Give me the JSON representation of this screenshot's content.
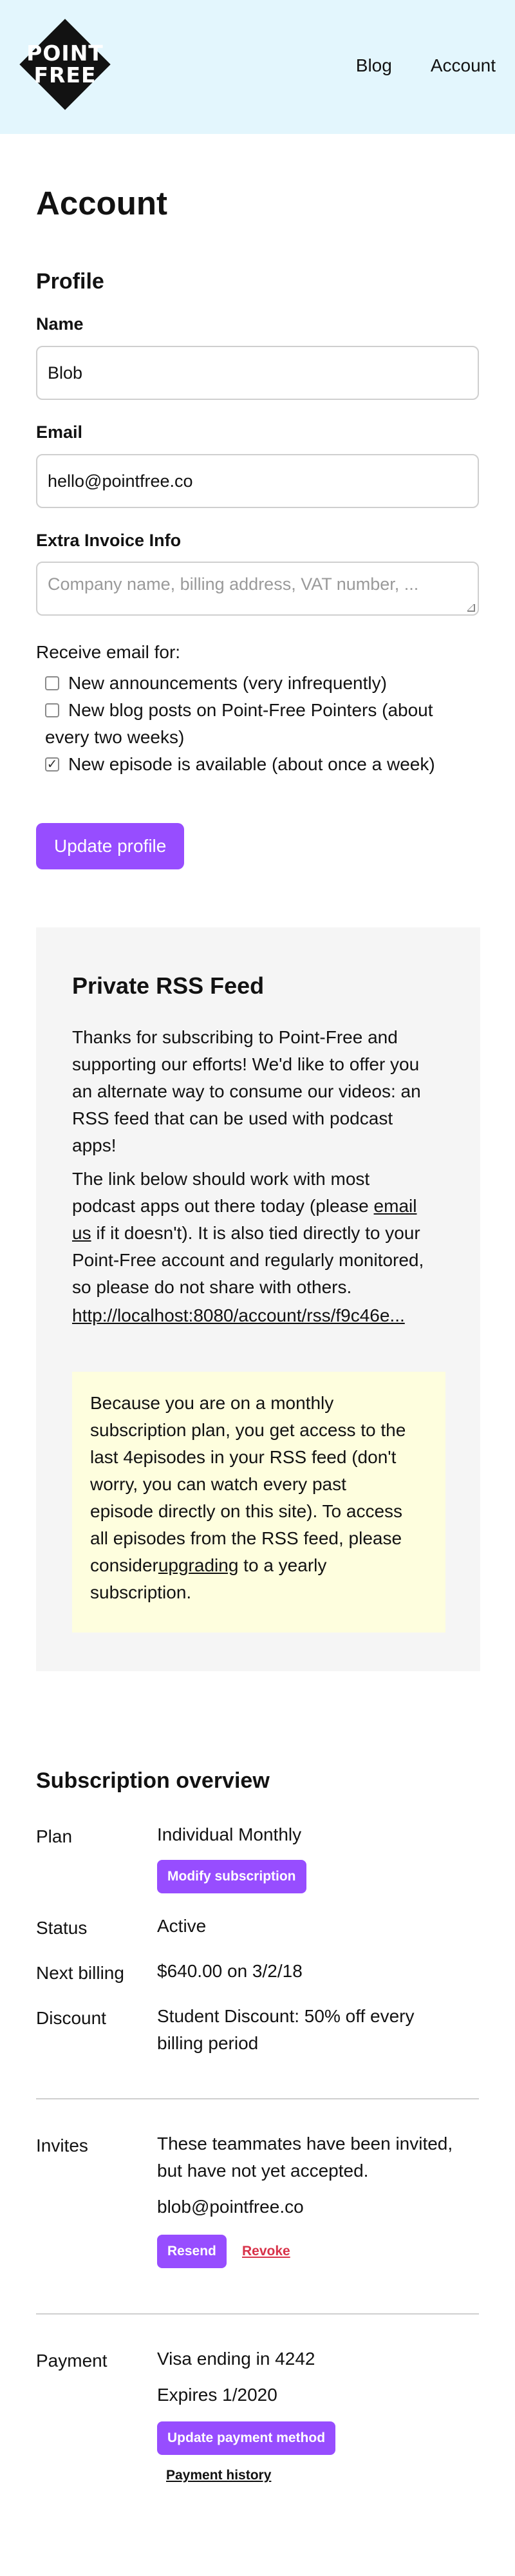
{
  "header": {
    "logo_line1": "POINT",
    "logo_line2": "FREE",
    "nav": {
      "blog": "Blog",
      "account": "Account"
    }
  },
  "page_title": "Account",
  "profile": {
    "title": "Profile",
    "name_label": "Name",
    "name_value": "Blob",
    "email_label": "Email",
    "email_value": "hello@pointfree.co",
    "invoice_label": "Extra Invoice Info",
    "invoice_placeholder": "Company name, billing address, VAT number, ...",
    "receive_label": "Receive email for:",
    "checkboxes": [
      {
        "label": "New announcements (very infrequently)",
        "checked": false
      },
      {
        "label_line1": "New blog posts on Point-Free Pointers (about",
        "label_line2": "every two weeks)",
        "checked": false
      },
      {
        "label": "New episode is available (about once a week)",
        "checked": true
      }
    ],
    "update_button": "Update profile"
  },
  "rss": {
    "title": "Private RSS Feed",
    "p1": [
      "Thanks for subscribing to Point-Free and",
      "supporting our efforts! We'd like to offer you",
      "an alternate way to consume our videos: an",
      "RSS feed that can be used with podcast",
      "apps!"
    ],
    "p2_line1": "The link below should work with most",
    "p2_line2_pre": "podcast apps out there today (please ",
    "p2_line2_link": "email",
    "p2_line3_link": "us",
    "p2_line3_post": " if it doesn't). It is also tied directly to your",
    "p2_line4": "Point-Free account and regularly monitored,",
    "p2_line5": "so please do not share with others.",
    "feed_url": "http://localhost:8080/account/rss/f9c46e...",
    "notice_lines": [
      "Because you are on a monthly",
      "subscription plan, you get access to the",
      "last 4episodes in your RSS feed (don't",
      "worry, you can watch every past",
      "episode directly on this site). To access",
      "all episodes from the RSS feed, please"
    ],
    "notice_consider": "consider",
    "notice_upgrading": "upgrading",
    "notice_tail": " to a yearly",
    "notice_last": "subscription."
  },
  "subscription": {
    "title": "Subscription overview",
    "plan_label": "Plan",
    "plan_value": "Individual Monthly",
    "modify_button": "Modify subscription",
    "status_label": "Status",
    "status_value": "Active",
    "next_billing_label": "Next billing",
    "next_billing_value": "$640.00 on 3/2/18",
    "discount_label": "Discount",
    "discount_line1": "Student Discount: 50% off every",
    "discount_line2": "billing period",
    "invites_label": "Invites",
    "invites_line1": "These teammates have been invited,",
    "invites_line2": "but have not yet accepted.",
    "invite_email": "blob@pointfree.co",
    "resend_button": "Resend",
    "revoke_link": "Revoke",
    "payment_label": "Payment",
    "payment_card": "Visa ending in 4242",
    "payment_expires": "Expires 1/2020",
    "update_payment_button": "Update payment method",
    "payment_history_link": "Payment history"
  },
  "colors": {
    "header_bg": "#e3f6fd",
    "accent": "#974dff",
    "danger": "#d8334a",
    "notice_bg": "#fefede",
    "panel_bg": "#f5f5f5"
  }
}
